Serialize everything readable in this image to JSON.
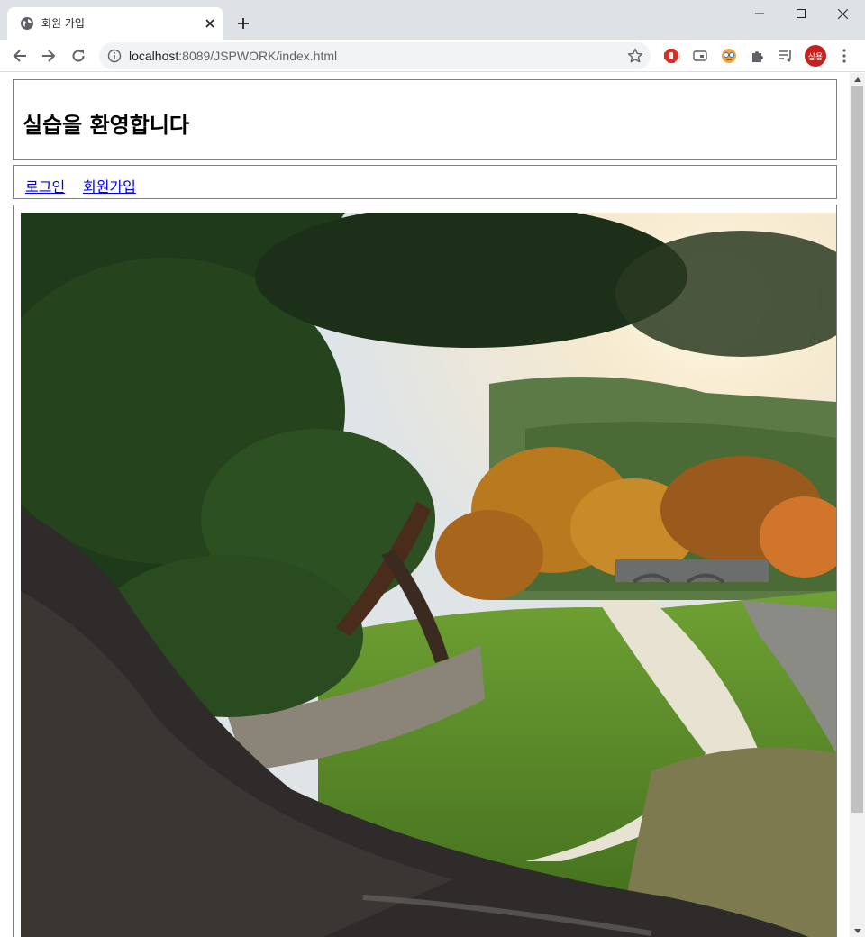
{
  "browser": {
    "tab_title": "회원 가입",
    "url_host": "localhost",
    "url_rest": ":8089/JSPWORK/index.html",
    "profile_initials": "상용"
  },
  "page": {
    "title": "실습을 환영합니다",
    "nav": [
      {
        "label": "로그인"
      },
      {
        "label": "회원가입"
      }
    ]
  },
  "colors": {
    "link": "#0000ee",
    "frame_border": "#808080",
    "profile": "#c5221f"
  }
}
